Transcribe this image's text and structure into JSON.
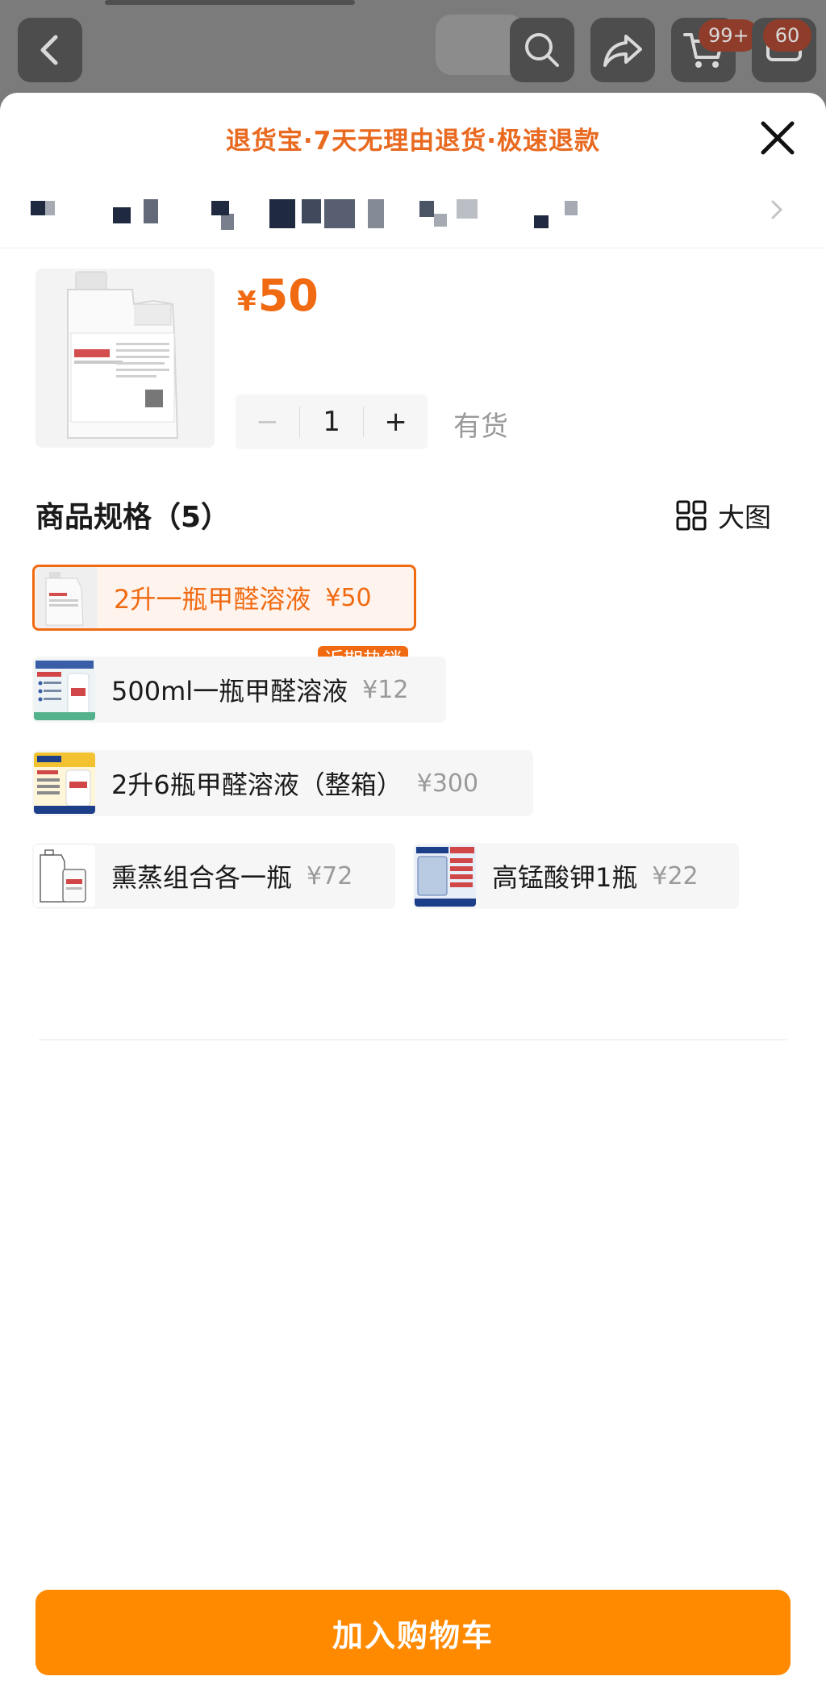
{
  "header": {
    "cart_badge": "99+",
    "message_badge": "60"
  },
  "sheet": {
    "banner": "退货宝·7天无理由退货·极速退款",
    "address_obscured": true
  },
  "product": {
    "currency": "¥",
    "price": "50",
    "quantity": "1",
    "minus_label": "−",
    "plus_label": "+",
    "stock_label": "有货"
  },
  "specs": {
    "title": "商品规格（5）",
    "bigview_label": "大图",
    "hot_tag": "近期热销",
    "items": [
      {
        "name": "2升一瓶甲醛溶液",
        "price": "¥50",
        "selected": true
      },
      {
        "name": "500ml一瓶甲醛溶液",
        "price": "¥12",
        "selected": false
      },
      {
        "name": "2升6瓶甲醛溶液（整箱）",
        "price": "¥300",
        "selected": false
      },
      {
        "name": "熏蒸组合各一瓶",
        "price": "¥72",
        "selected": false
      },
      {
        "name": "高锰酸钾1瓶",
        "price": "¥22",
        "selected": false
      }
    ]
  },
  "footer": {
    "add_to_cart": "加入购物车"
  },
  "colors": {
    "accent": "#f06a12",
    "cart_button": "#ff8a00",
    "banner_text": "#e8691f"
  }
}
